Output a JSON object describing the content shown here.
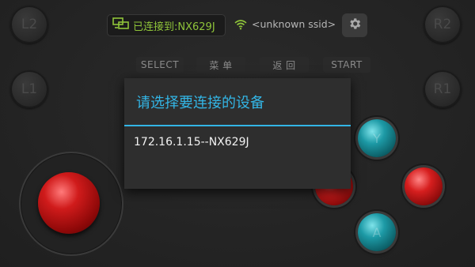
{
  "status": {
    "connected_label": "已连接到:NX629J",
    "ssid": "<unknown ssid>"
  },
  "shoulders": {
    "l2": "L2",
    "r2": "R2",
    "l1": "L1",
    "r1": "R1"
  },
  "menu": {
    "select": "SELECT",
    "menu": "菜 单",
    "back": "返 回",
    "start": "START"
  },
  "face_buttons": {
    "top": "Y",
    "bottom": "A"
  },
  "dialog": {
    "title": "请选择要连接的设备",
    "items": [
      "172.16.1.15--NX629J"
    ]
  },
  "colors": {
    "accent": "#33b5e5",
    "connected": "#8fc43a",
    "joystick": "#d01b1b",
    "teal_button": "#1d9aa6",
    "red_button": "#d61e1e"
  }
}
